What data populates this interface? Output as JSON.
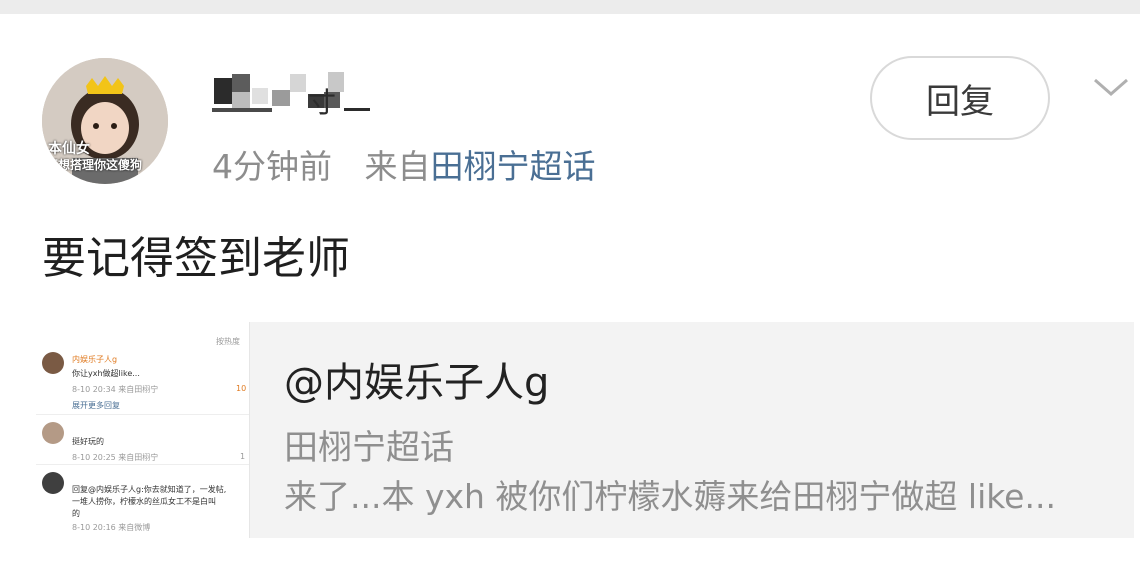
{
  "post": {
    "username": "",
    "time": "4分钟前",
    "source_prefix": "来自",
    "source_topic": "田栩宁超话",
    "reply_label": "回复",
    "content": "要记得签到老师",
    "avatar_text_line1": "本仙女",
    "avatar_text_line2": "不想搭理你这傻狗"
  },
  "card": {
    "title": "@内娱乐子人g",
    "subtitle": "田栩宁超话",
    "description": "来了...本 yxh 被你们柠檬水薅来给田栩宁做超 like..."
  },
  "thumbnail": {
    "sort_label": "按热度",
    "c1_name": "内娱乐子人g",
    "c1_text": "你让yxh做超like...",
    "c1_meta": "8-10 20:34 来自田栩宁",
    "c1_likes": "10",
    "expand_label": "展开更多回复",
    "c2_text": "挺好玩的",
    "c2_meta": "8-10 20:25 来自田栩宁",
    "c2_likes": "1",
    "c3_text_line1": "回复@内娱乐子人g:你去就知道了，一发帖,",
    "c3_text_line2": "一堆人捞你，柠檬水的丝瓜女工不是白叫",
    "c3_text_line3": "的",
    "c3_meta": "8-10 20:16 来自微博"
  },
  "colors": {
    "topic_link": "#4a6f94",
    "meta_gray": "#8d8d8d",
    "card_bg": "#f3f3f3"
  }
}
